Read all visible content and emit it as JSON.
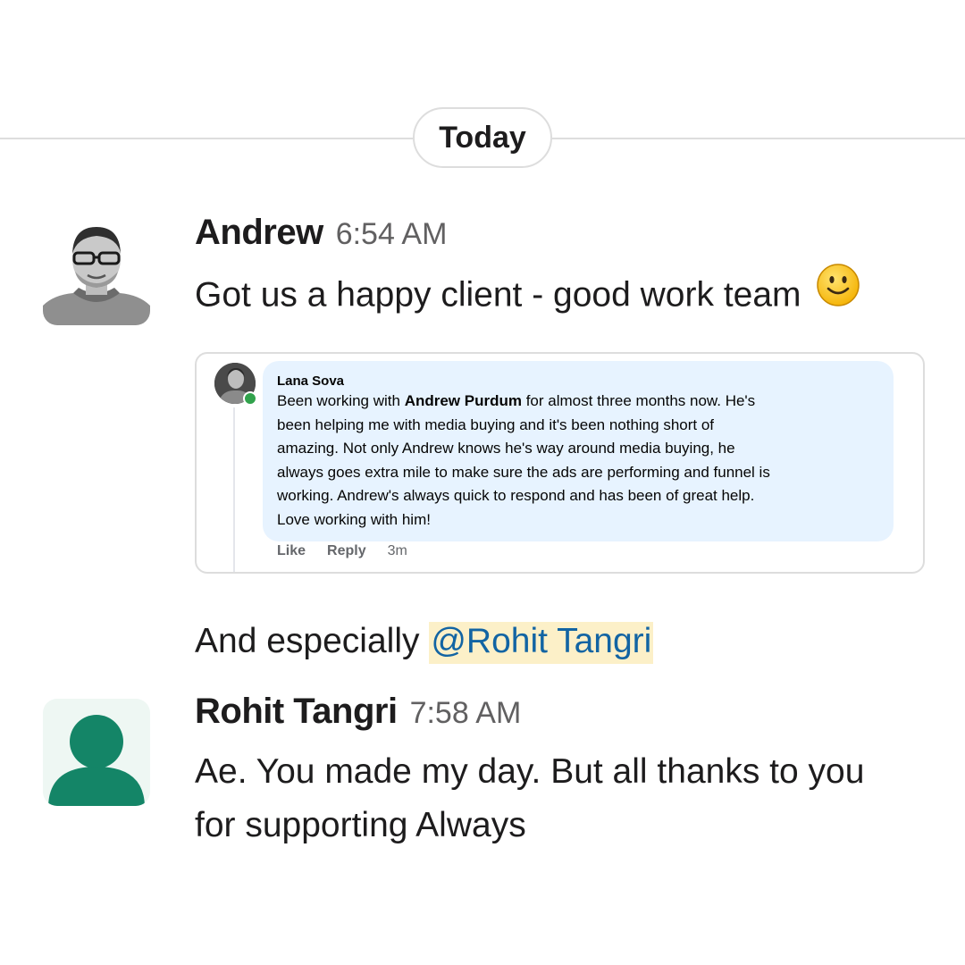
{
  "divider": {
    "label": "Today"
  },
  "messages": [
    {
      "author": "Andrew",
      "time": "6:54 AM",
      "text": "Got us a happy client - good work team",
      "emoji": "slightly-smiling-face-icon",
      "embed": {
        "commenter": "Lana Sova",
        "comment_lines": [
          {
            "pre": "Been working with ",
            "bold": "Andrew Purdum",
            "post": " for almost three months now. He's"
          },
          {
            "text": "been helping me with media buying and it's been nothing short of"
          },
          {
            "text": "amazing. Not only Andrew knows he's way around media buying, he"
          },
          {
            "text": "always goes extra mile to make sure the ads are performing and funnel is"
          },
          {
            "text": "working. Andrew's always quick to respond and has been of great help."
          },
          {
            "text": "Love working with him!"
          }
        ],
        "actions": {
          "like": "Like",
          "reply": "Reply",
          "age": "3m"
        }
      },
      "followup": {
        "text": "And especially ",
        "mention": "@Rohit Tangri"
      }
    },
    {
      "author": "Rohit Tangri",
      "time": "7:58 AM",
      "text_lines": [
        "Ae. You made my day. But all thanks to you",
        "for supporting Always"
      ]
    }
  ],
  "colors": {
    "mention_bg": "#fcf0c8",
    "mention_text": "#1264a3",
    "default_avatar": "#148567",
    "comment_bubble": "#e7f3ff"
  }
}
